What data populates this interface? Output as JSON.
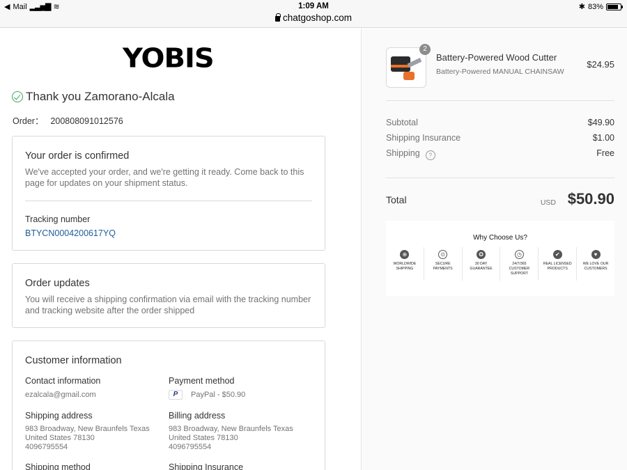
{
  "status_bar": {
    "back_app": "Mail",
    "time": "1:09 AM",
    "url": "chatgoshop.com",
    "battery": "83%",
    "battery_level": 0.83
  },
  "store": {
    "logo_text": "YOBIS"
  },
  "thank_you": {
    "text": "Thank you Zamorano-Alcala"
  },
  "order": {
    "label": "Order：",
    "number": "200808091012576"
  },
  "confirmed_card": {
    "title": "Your order is confirmed",
    "message": "We've accepted your order, and we're getting it ready. Come back to this page for updates on your shipment status.",
    "tracking_label": "Tracking number",
    "tracking_number": "BTYCN0004200617YQ"
  },
  "updates_card": {
    "title": "Order updates",
    "message": "You will receive a shipping confirmation via email with the tracking number and tracking website after the order shipped"
  },
  "customer_card": {
    "title": "Customer information",
    "contact_label": "Contact information",
    "contact_value": "ezalcala@gmail.com",
    "payment_label": "Payment method",
    "payment_value": "PayPal - $50.90",
    "shipping_address_label": "Shipping address",
    "shipping_address_lines": [
      "983 Broadway, New Braunfels Texas",
      "United States 78130",
      "4096795554"
    ],
    "billing_address_label": "Billing address",
    "billing_address_lines": [
      "983 Broadway, New Braunfels Texas",
      "United States 78130",
      "4096795554"
    ],
    "shipping_method_label": "Shipping method",
    "shipping_insurance_label": "Shipping Insurance"
  },
  "summary": {
    "product": {
      "title": "Battery-Powered Wood Cutter",
      "variant": "Battery-Powered MANUAL CHAINSAW",
      "price": "$24.95",
      "quantity": "2"
    },
    "subtotal_label": "Subtotal",
    "subtotal_value": "$49.90",
    "insurance_label": "Shipping Insurance",
    "insurance_value": "$1.00",
    "shipping_label": "Shipping",
    "shipping_value": "Free",
    "total_label": "Total",
    "total_currency": "USD",
    "total_value": "$50.90"
  },
  "why_choose": {
    "title": "Why Choose Us?",
    "badges": [
      {
        "icon": "globe-icon",
        "glyph": "⊕",
        "label": "WORLDWIDE SHIPPING"
      },
      {
        "icon": "secure-payment-icon",
        "glyph": "⊙",
        "label": "SECURE PAYMENTS"
      },
      {
        "icon": "guarantee-ribbon-icon",
        "glyph": "✪",
        "label": "30 DAY GUARANTEE"
      },
      {
        "icon": "support-clock-icon",
        "glyph": "◷",
        "label": "24/7/365 CUSTOMER SUPPORT"
      },
      {
        "icon": "checkmark-icon",
        "glyph": "✔",
        "label": "REAL LICENSED PRODUCTS"
      },
      {
        "icon": "heart-icon",
        "glyph": "♥",
        "label": "WE LOVE OUR CUSTOMERS"
      }
    ]
  },
  "colors": {
    "success_green": "#3aa55c",
    "tracking_link": "#1f5c99",
    "muted_text": "#737373",
    "summary_bg": "#fafafa"
  }
}
